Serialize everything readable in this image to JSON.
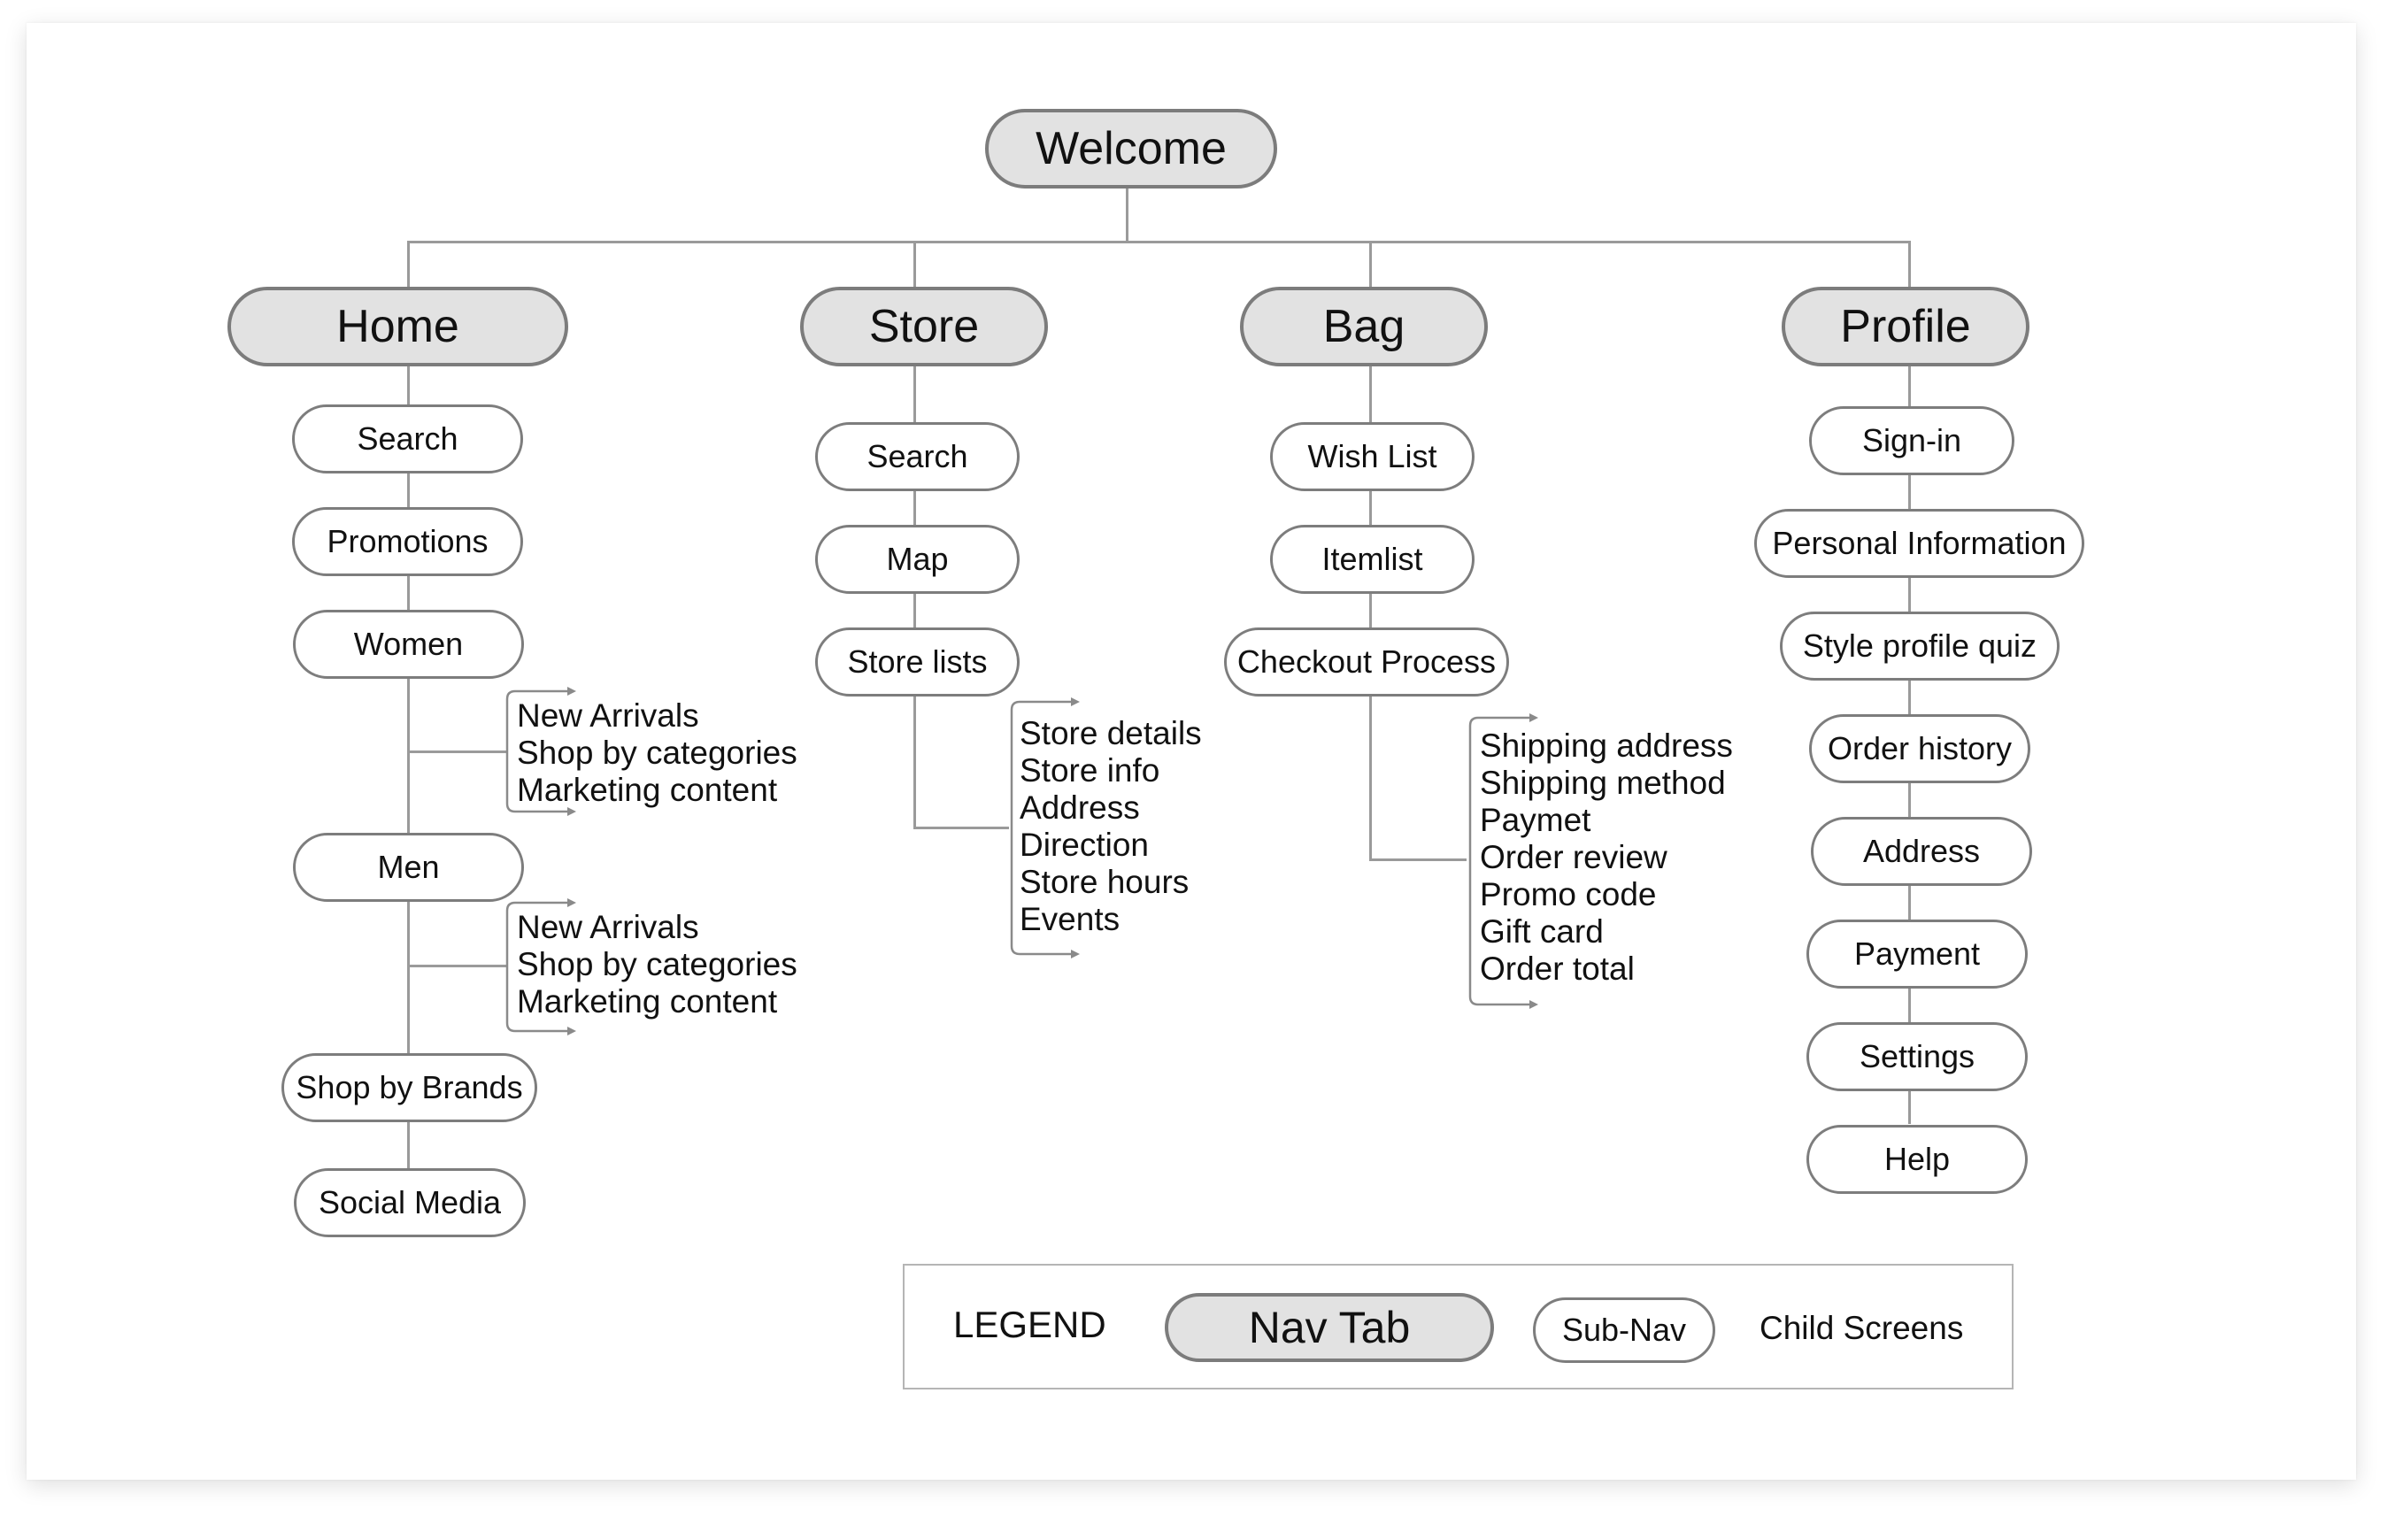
{
  "root": {
    "label": "Welcome"
  },
  "nav_tabs": [
    {
      "label": "Home",
      "subnav": [
        {
          "label": "Search"
        },
        {
          "label": "Promotions"
        },
        {
          "label": "Women",
          "children": [
            "New Arrivals",
            "Shop by categories",
            "Marketing content"
          ]
        },
        {
          "label": "Men",
          "children": [
            "New Arrivals",
            "Shop by categories",
            "Marketing content"
          ]
        },
        {
          "label": "Shop by Brands"
        },
        {
          "label": "Social Media"
        }
      ]
    },
    {
      "label": "Store",
      "subnav": [
        {
          "label": "Search"
        },
        {
          "label": "Map"
        },
        {
          "label": "Store lists",
          "children": [
            "Store details",
            "Store info",
            "Address",
            "Direction",
            "Store hours",
            "Events"
          ]
        }
      ]
    },
    {
      "label": "Bag",
      "subnav": [
        {
          "label": "Wish List"
        },
        {
          "label": "Itemlist"
        },
        {
          "label": "Checkout Process",
          "children": [
            "Shipping address",
            "Shipping method",
            "Paymet",
            "Order review",
            "Promo code",
            "Gift card",
            "Order total"
          ]
        }
      ]
    },
    {
      "label": "Profile",
      "subnav": [
        {
          "label": "Sign-in"
        },
        {
          "label": "Personal Information"
        },
        {
          "label": "Style profile quiz"
        },
        {
          "label": "Order history"
        },
        {
          "label": "Address"
        },
        {
          "label": "Payment"
        },
        {
          "label": "Settings"
        },
        {
          "label": "Help"
        }
      ]
    }
  ],
  "legend": {
    "title": "LEGEND",
    "nav_tab": "Nav Tab",
    "sub_nav": "Sub-Nav",
    "child_screens": "Child Screens"
  },
  "colors": {
    "nav_fill": "#e2e2e2",
    "nav_border": "#7c7c7c",
    "subnav_border": "#7d7d7d",
    "connector": "#9a9a9a"
  }
}
